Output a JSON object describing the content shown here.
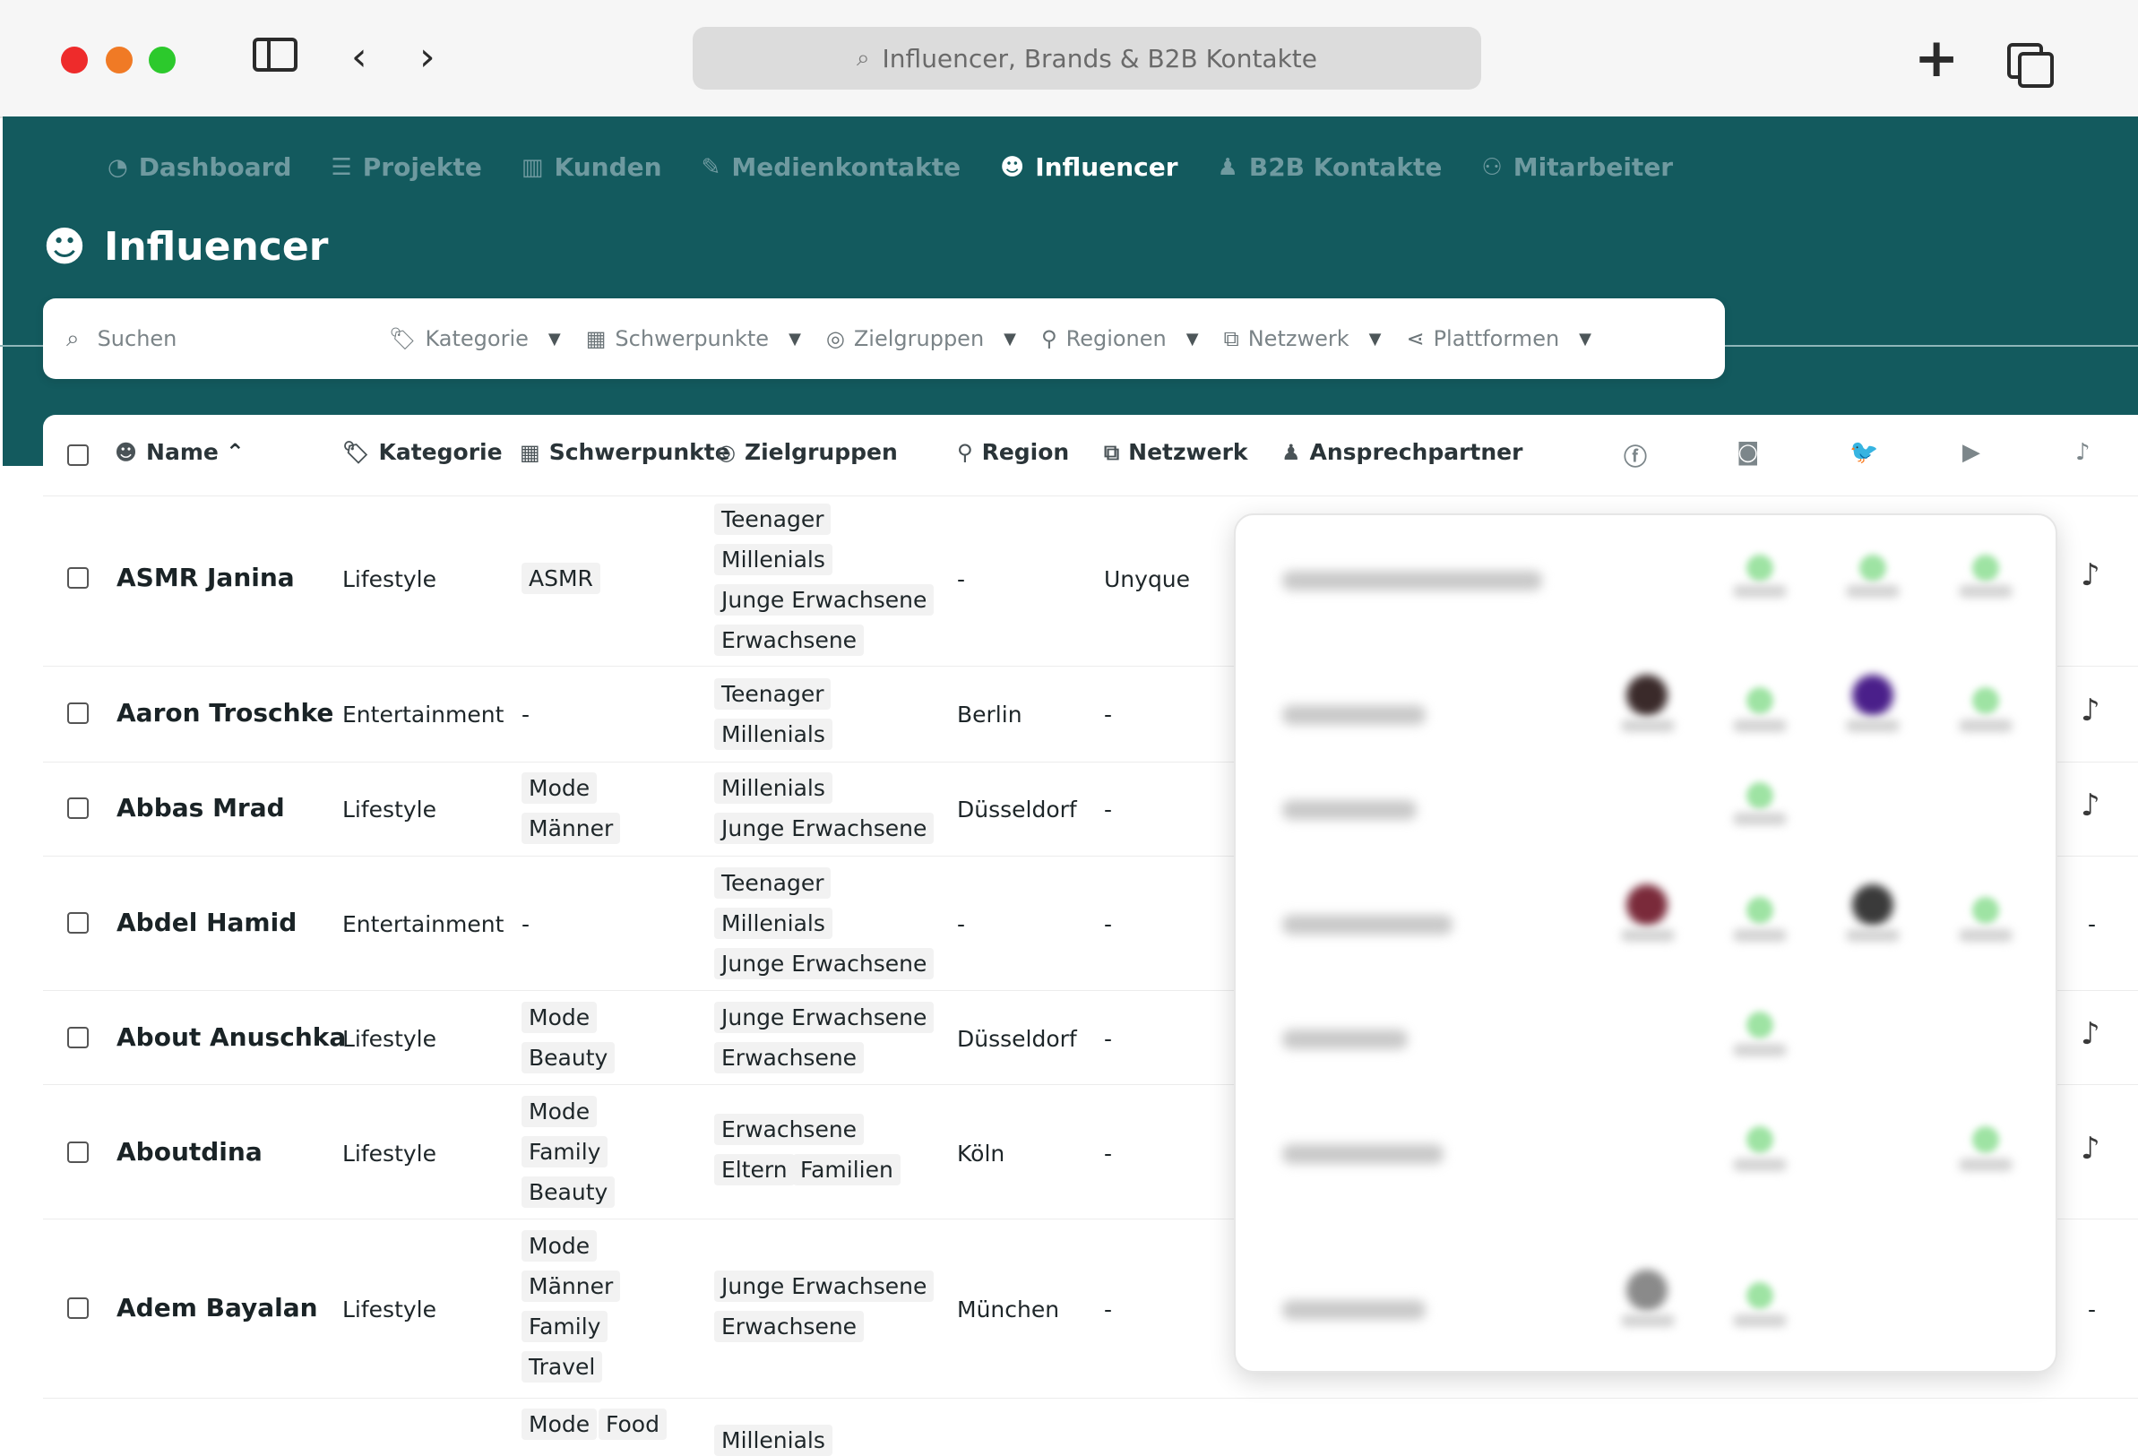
{
  "browser": {
    "address": "Influencer, Brands & B2B Kontakte"
  },
  "nav": [
    {
      "label": "Dashboard",
      "icon": "dashboard-icon"
    },
    {
      "label": "Projekte",
      "icon": "list-icon"
    },
    {
      "label": "Kunden",
      "icon": "building-icon"
    },
    {
      "label": "Medienkontakte",
      "icon": "user-pen-icon"
    },
    {
      "label": "Influencer",
      "icon": "smile-icon"
    },
    {
      "label": "B2B Kontakte",
      "icon": "user-tie-icon"
    },
    {
      "label": "Mitarbeiter",
      "icon": "users-icon"
    }
  ],
  "page": {
    "title": "Influencer"
  },
  "search": {
    "placeholder": "Suchen",
    "filters": [
      "Kategorie",
      "Schwerpunkte",
      "Zielgruppen",
      "Regionen",
      "Netzwerk",
      "Plattformen"
    ]
  },
  "table": {
    "headers": {
      "name": "Name",
      "kategorie": "Kategorie",
      "schwerpunkte": "Schwerpunkte",
      "zielgruppen": "Zielgruppen",
      "region": "Region",
      "netzwerk": "Netzwerk",
      "ansprechpartner": "Ansprechpartner"
    },
    "social_icons": [
      "facebook-icon",
      "instagram-icon",
      "twitter-icon",
      "youtube-icon",
      "tiktok-icon"
    ],
    "rows": [
      {
        "name": "ASMR Janina",
        "kategorie": "Lifestyle",
        "schwerpunkte": [
          "ASMR"
        ],
        "zielgruppen": [
          "Teenager",
          "Millenials",
          "Junge Erwachsene",
          "Erwachsene"
        ],
        "region": "-",
        "netzwerk": "Unyque",
        "tiktok": "tiktok"
      },
      {
        "name": "Aaron Troschke",
        "kategorie": "Entertainment",
        "schwerpunkte": [
          "-"
        ],
        "zielgruppen": [
          "Teenager",
          "Millenials"
        ],
        "region": "Berlin",
        "netzwerk": "-",
        "tiktok": "tiktok"
      },
      {
        "name": "Abbas Mrad",
        "kategorie": "Lifestyle",
        "schwerpunkte": [
          "Mode",
          "Männer"
        ],
        "zielgruppen": [
          "Millenials",
          "Junge Erwachsene"
        ],
        "region": "Düsseldorf",
        "netzwerk": "-",
        "tiktok": "tiktok"
      },
      {
        "name": "Abdel Hamid",
        "kategorie": "Entertainment",
        "schwerpunkte": [
          "-"
        ],
        "zielgruppen": [
          "Teenager",
          "Millenials",
          "Junge Erwachsene"
        ],
        "region": "-",
        "netzwerk": "-",
        "tiktok": "-"
      },
      {
        "name": "About Anuschka",
        "kategorie": "Lifestyle",
        "schwerpunkte": [
          "Mode",
          "Beauty"
        ],
        "zielgruppen": [
          "Junge Erwachsene",
          "Erwachsene"
        ],
        "region": "Düsseldorf",
        "netzwerk": "-",
        "tiktok": "tiktok"
      },
      {
        "name": "Aboutdina",
        "kategorie": "Lifestyle",
        "schwerpunkte": [
          "Mode",
          "Family",
          "Beauty"
        ],
        "zielgruppen": [
          "Erwachsene",
          "Eltern",
          "Familien"
        ],
        "region": "Köln",
        "netzwerk": "-",
        "tiktok": "tiktok"
      },
      {
        "name": "Adem Bayalan",
        "kategorie": "Lifestyle",
        "schwerpunkte": [
          "Mode",
          "Männer",
          "Family",
          "Travel"
        ],
        "zielgruppen": [
          "Junge Erwachsene",
          "Erwachsene"
        ],
        "region": "München",
        "netzwerk": "-",
        "tiktok": "-"
      },
      {
        "name": "",
        "kategorie": "",
        "schwerpunkte": [
          "Mode",
          "Food"
        ],
        "zielgruppen": [
          "Millenials"
        ],
        "region": "",
        "netzwerk": "",
        "tiktok": ""
      }
    ]
  }
}
